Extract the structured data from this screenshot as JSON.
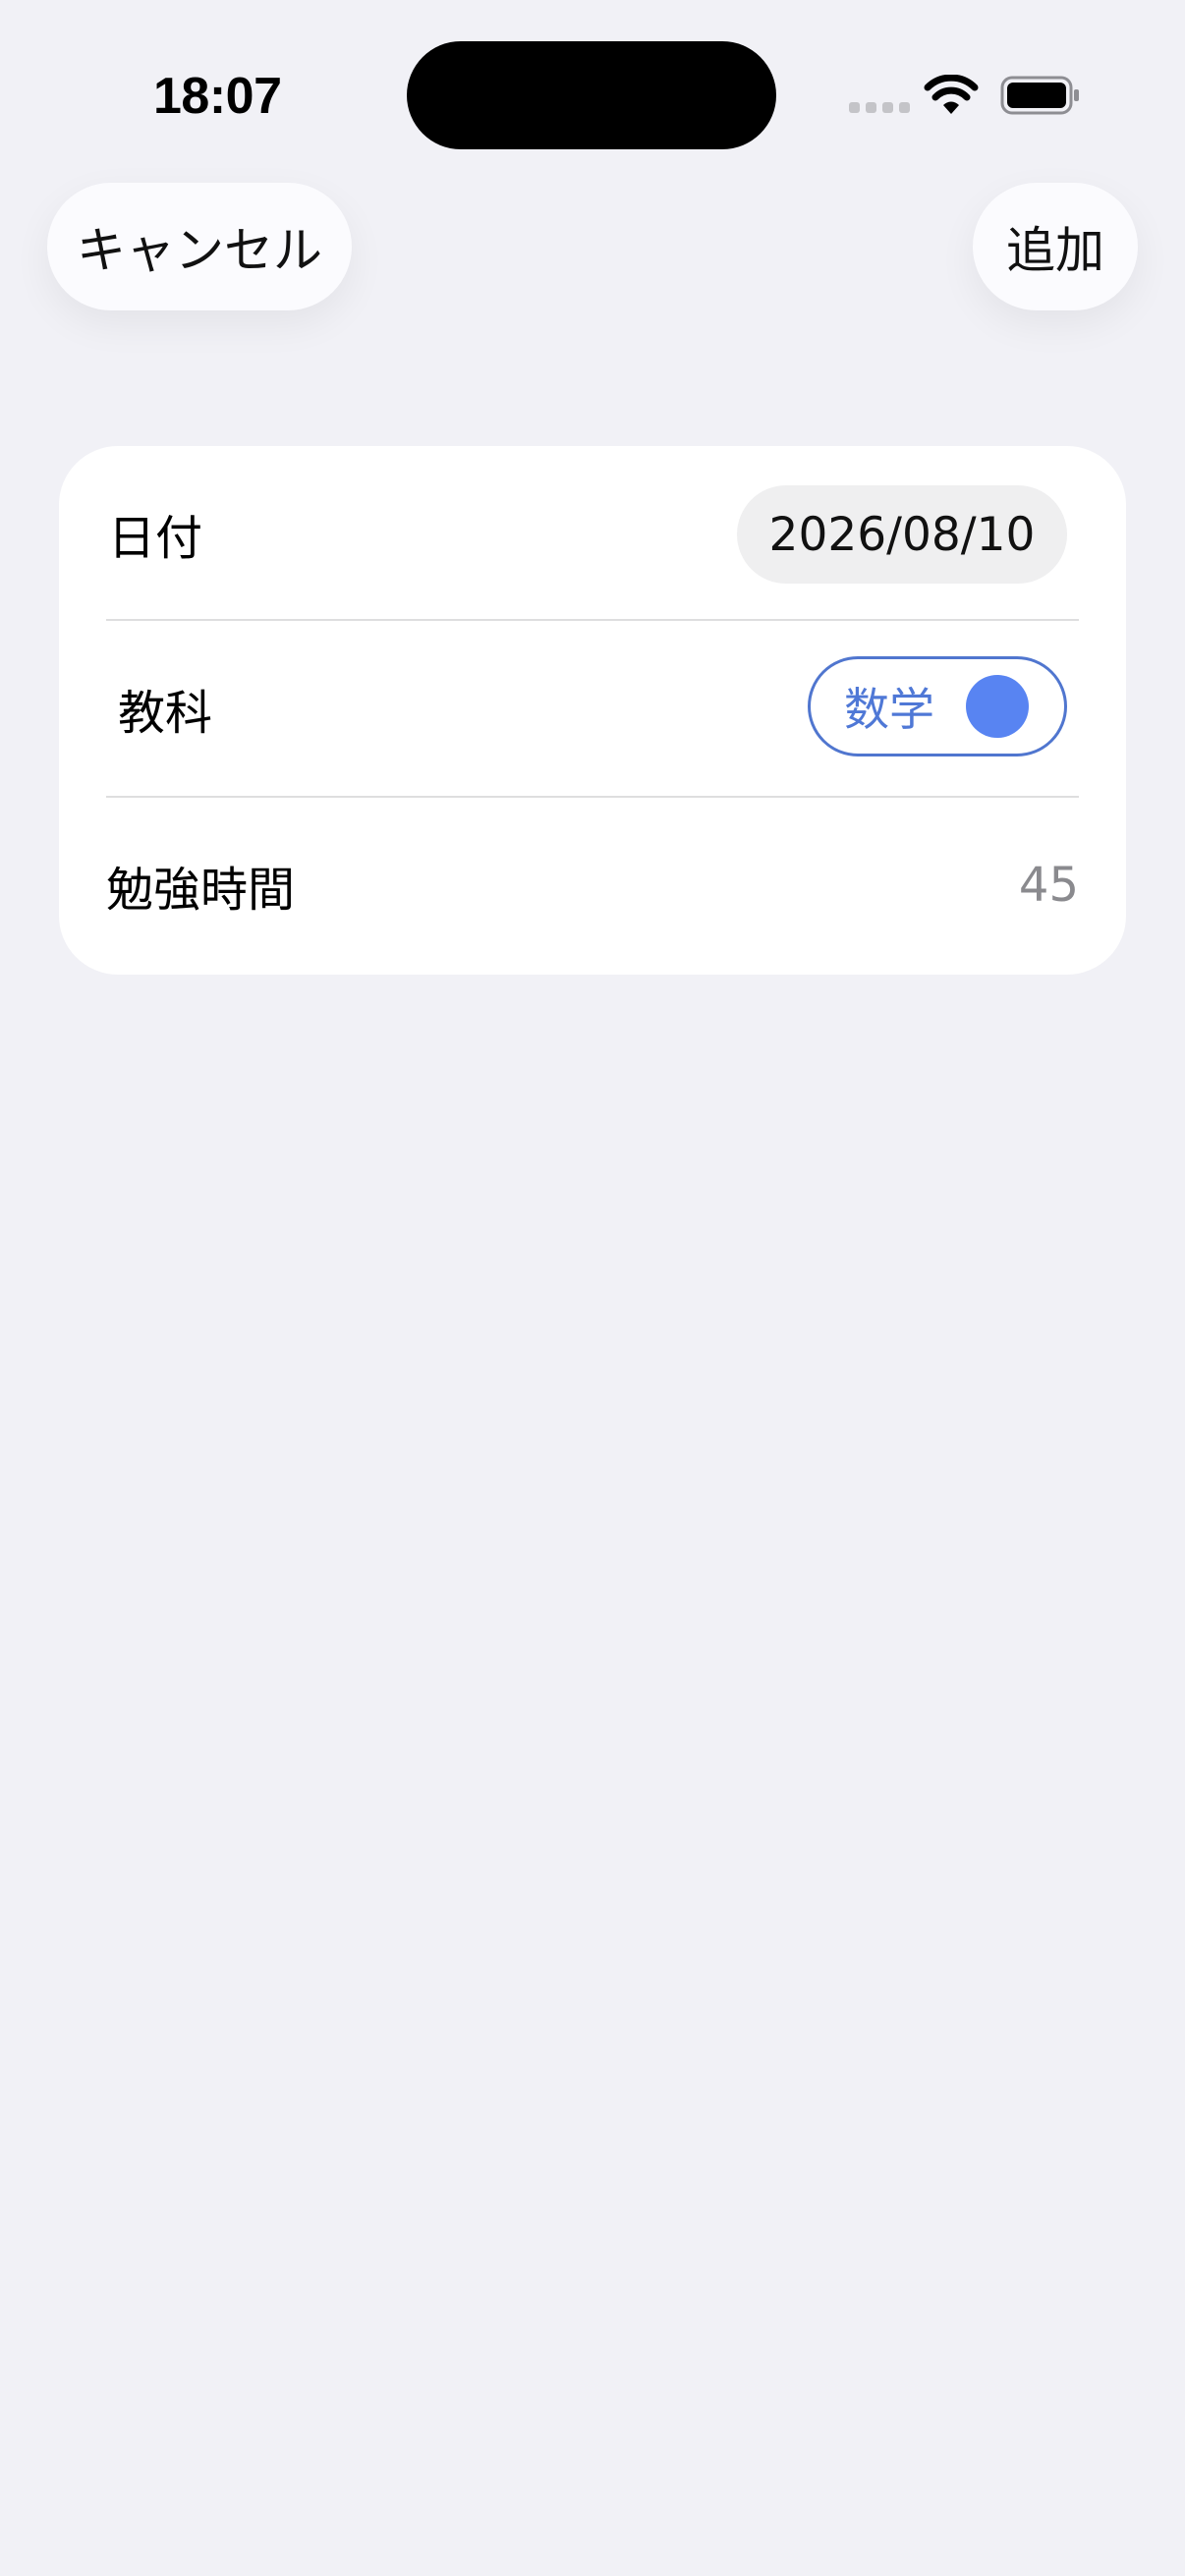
{
  "status_bar": {
    "time": "18:07",
    "icons": [
      "cellular-signal-icon",
      "wifi-icon",
      "battery-icon"
    ]
  },
  "nav": {
    "cancel_label": "キャンセル",
    "add_label": "追加"
  },
  "form": {
    "date_label": "日付",
    "date_value": "2026/08/10",
    "subject_label": "教科",
    "subject_value": "数学",
    "duration_label": "勉強時間",
    "duration_value": "45"
  },
  "colors": {
    "background": "#f1f1f6",
    "card": "#ffffff",
    "accent": "#5884f2",
    "accent_text": "#4f78d6",
    "secondary_text": "#8a8a8e"
  }
}
